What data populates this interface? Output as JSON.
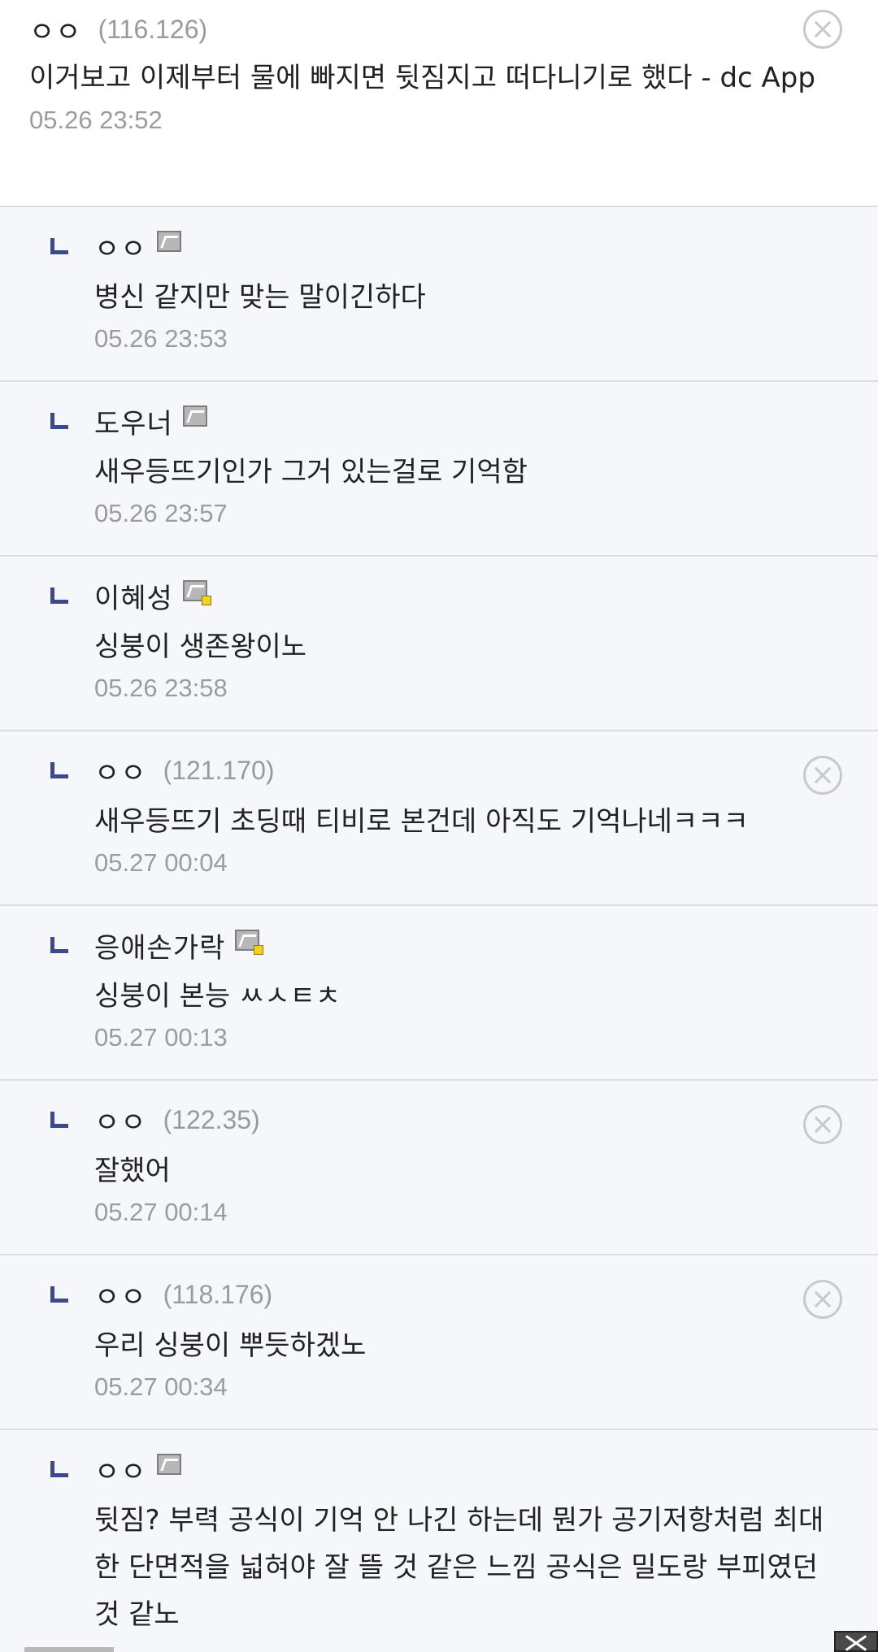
{
  "comments": [
    {
      "nick": "ㅇㅇ",
      "ip": "(116.126)",
      "body": "이거보고 이제부터 물에 빠지면 뒷짐지고 떠다니기로 했다 - dc App",
      "date": "05.26 23:52"
    },
    {
      "nick": "ㅇㅇ",
      "body": "병신 같지만 맞는 말이긴하다",
      "date": "05.26 23:53"
    },
    {
      "nick": "도우너",
      "body": "새우등뜨기인가 그거 있는걸로 기억함",
      "date": "05.26 23:57"
    },
    {
      "nick": "이혜성",
      "body": "싱붕이 생존왕이노",
      "date": "05.26 23:58"
    },
    {
      "nick": "ㅇㅇ",
      "ip": "(121.170)",
      "body": "새우등뜨기 초딩때 티비로 본건데 아직도 기억나네ㅋㅋㅋ",
      "date": "05.27 00:04"
    },
    {
      "nick": "응애손가락",
      "body": "싱붕이 본능 ㅆㅅㅌㅊ",
      "date": "05.27 00:13"
    },
    {
      "nick": "ㅇㅇ",
      "ip": "(122.35)",
      "body": "잘했어",
      "date": "05.27 00:14"
    },
    {
      "nick": "ㅇㅇ",
      "ip": "(118.176)",
      "body": "우리 싱붕이 뿌듯하겠노",
      "date": "05.27 00:34"
    },
    {
      "nick": "ㅇㅇ",
      "body": "뒷짐? 부력 공식이 기억 안 나긴 하는데 뭔가 공기저항처럼 최대한 단면적을 넓혀야 잘 뜰 것 같은 느낌 공식은 밀도랑 부피였던 것 같노"
    }
  ]
}
